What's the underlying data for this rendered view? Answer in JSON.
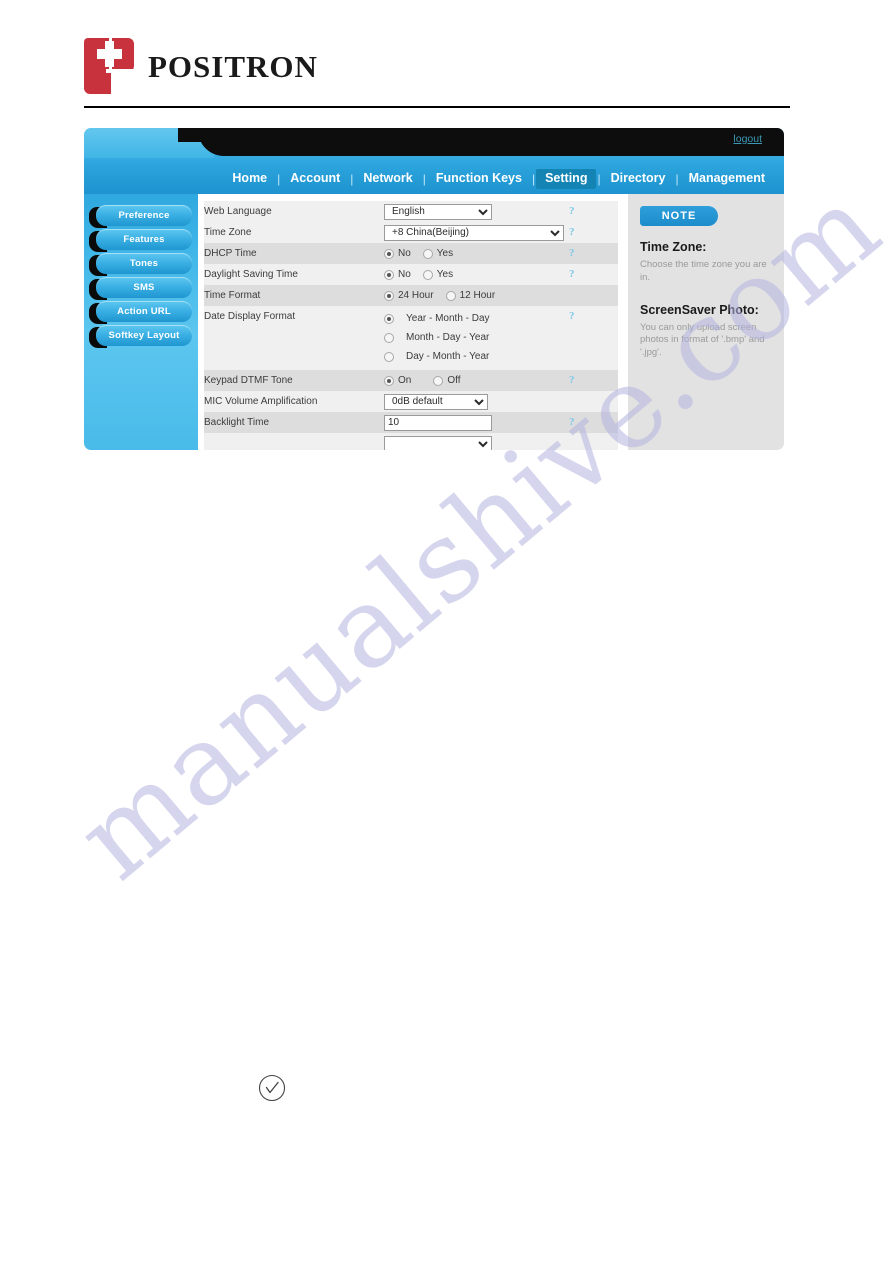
{
  "brand": {
    "logo_text": "POSITRON",
    "logo_icon": "positron-block-p-logo"
  },
  "app": {
    "logout_label": "logout",
    "nav_items": [
      {
        "label": "Home",
        "active": false
      },
      {
        "label": "Account",
        "active": false
      },
      {
        "label": "Network",
        "active": false
      },
      {
        "label": "Function Keys",
        "active": false
      },
      {
        "label": "Setting",
        "active": true
      },
      {
        "label": "Directory",
        "active": false
      },
      {
        "label": "Management",
        "active": false
      }
    ],
    "nav_separator": "|"
  },
  "sidebar": {
    "items": [
      {
        "label": "Preference"
      },
      {
        "label": "Features"
      },
      {
        "label": "Tones"
      },
      {
        "label": "SMS"
      },
      {
        "label": "Action URL"
      },
      {
        "label": "Softkey Layout"
      }
    ]
  },
  "form": {
    "help_glyph": "?",
    "rows": {
      "web_language": {
        "label": "Web Language",
        "value": "English",
        "options": [
          "English"
        ]
      },
      "time_zone": {
        "label": "Time Zone",
        "value": "+8 China(Beijing)",
        "options": [
          "+8 China(Beijing)"
        ]
      },
      "dhcp_time": {
        "label": "DHCP Time",
        "options": [
          "No",
          "Yes"
        ],
        "selected": "No"
      },
      "daylight_saving_time": {
        "label": "Daylight Saving Time",
        "options": [
          "No",
          "Yes"
        ],
        "selected": "No"
      },
      "time_format": {
        "label": "Time Format",
        "options": [
          "24 Hour",
          "12 Hour"
        ],
        "selected": "24 Hour"
      },
      "date_display_format": {
        "label": "Date Display Format",
        "options": [
          "Year - Month - Day",
          "Month - Day - Year",
          "Day - Month - Year"
        ],
        "selected": "Year - Month - Day"
      },
      "keypad_dtmf_tone": {
        "label": "Keypad DTMF Tone",
        "options": [
          "On",
          "Off"
        ],
        "selected": "On"
      },
      "mic_volume_amplification": {
        "label": "MIC Volume Amplification",
        "value": "0dB default",
        "options": [
          "0dB default"
        ]
      },
      "backlight_time": {
        "label": "Backlight Time",
        "value": "10"
      }
    }
  },
  "note": {
    "badge": "NOTE",
    "sections": [
      {
        "heading": "Time Zone:",
        "body": "Choose the time zone you are in."
      },
      {
        "heading": "ScreenSaver Photo:",
        "body": "You can only upload screen photos in format of '.bmp' and '.jpg'."
      }
    ]
  },
  "watermark": {
    "text": "manualshive.com"
  },
  "page_footer": {
    "check_icon": "circle-check-icon"
  },
  "colors": {
    "brand_red": "#c8323c",
    "nav_blue": "#2ba3dc",
    "active_tab": "#1484b5",
    "help_blue": "#7ec8e8",
    "row_dark": "#dddddd",
    "row_light": "#f0f0f0",
    "note_bg": "#e2e2e2",
    "watermark": "#b3b3e0"
  }
}
